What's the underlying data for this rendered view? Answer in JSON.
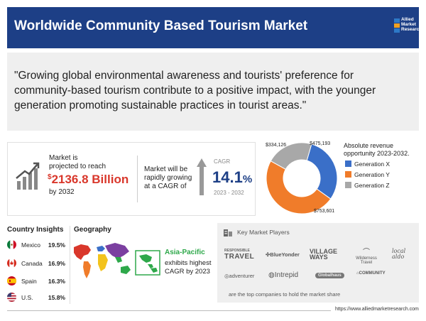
{
  "header": {
    "title": "Worldwide Community Based Tourism Market",
    "logo_text": [
      "Allied",
      "Market",
      "Research"
    ]
  },
  "quote": "\"Growing global environmental awareness and tourists' preference for community-based tourism contribute to a positive impact, with the younger generation promoting sustainable practices in tourist areas.\"",
  "stats": {
    "projection_line1": "Market is",
    "projection_line2": "projected to reach",
    "currency": "$",
    "value": "2136.8 Billion",
    "year": "by 2032",
    "growth_line1": "Market will be",
    "growth_line2": "rapidly growing",
    "growth_line3": "at a CAGR of",
    "cagr_label": "CAGR",
    "cagr_value": "14.1",
    "cagr_unit": "%",
    "cagr_years": "2023 - 2032"
  },
  "revenue": {
    "title": "Absolute revenue opportunity 2023-2032.",
    "colors": {
      "gen_x": "#3a6fc8",
      "gen_y": "#f07c2a",
      "gen_z": "#a8a8a8"
    },
    "segments": [
      {
        "name": "Generation X",
        "value": 475193,
        "label": "$475,193"
      },
      {
        "name": "Generation Y",
        "value": 753601,
        "label": "$753,601"
      },
      {
        "name": "Generation Z",
        "value": 334126,
        "label": "$334,126"
      }
    ]
  },
  "country_insights": {
    "title": "Country Insights",
    "rows": [
      {
        "name": "Mexico",
        "value": "19.5%"
      },
      {
        "name": "Canada",
        "value": "16.9%"
      },
      {
        "name": "Spain",
        "value": "16.3%"
      },
      {
        "name": "U.S.",
        "value": "15.8%"
      }
    ]
  },
  "geography": {
    "title": "Geography",
    "region": "Asia-Pacific",
    "desc_line1": "exhibits highest",
    "desc_line2": "CAGR by 2023"
  },
  "players": {
    "title": "Key Market Players",
    "logos": [
      "TRAVEL",
      "BlueYonder",
      "VILLAGE WAYS",
      "Wilderness Travel",
      "local aldo",
      "adventurer",
      "Intrepid",
      "Globalhaus",
      "COMMUNITY"
    ],
    "responsible": "RESPONSIBLE",
    "footnote": "are the top companies to hold the market share"
  },
  "footer": {
    "url": "https://www.alliedmarketresearch.com"
  }
}
